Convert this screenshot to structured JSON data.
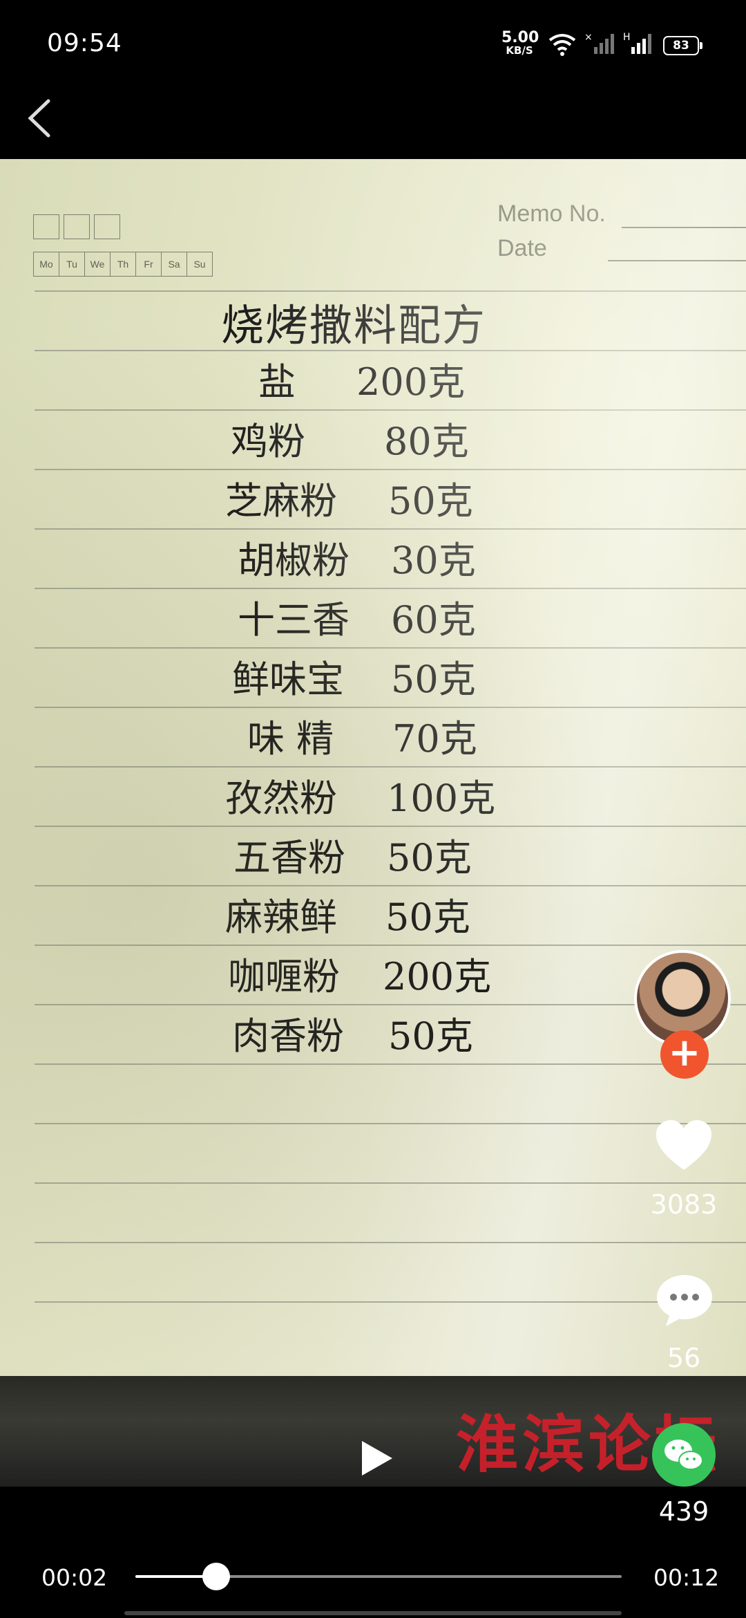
{
  "status": {
    "time": "09:54",
    "net_speed": "5.00",
    "net_unit": "KB/S",
    "battery": "83"
  },
  "memo": {
    "days": [
      "Mo",
      "Tu",
      "We",
      "Th",
      "Fr",
      "Sa",
      "Su"
    ],
    "memo_label": "Memo No.",
    "date_label": "Date",
    "title": "烧烤撒料配方",
    "rows": [
      {
        "name": "盐",
        "amount": "200克"
      },
      {
        "name": "鸡粉",
        "amount": "80克"
      },
      {
        "name": "芝麻粉",
        "amount": "50克"
      },
      {
        "name": "胡椒粉",
        "amount": "30克"
      },
      {
        "name": "十三香",
        "amount": "60克"
      },
      {
        "name": "鲜味宝",
        "amount": "50克"
      },
      {
        "name": "味 精",
        "amount": "70克"
      },
      {
        "name": "孜然粉",
        "amount": "100克"
      },
      {
        "name": "五香粉",
        "amount": "50克"
      },
      {
        "name": "麻辣鲜",
        "amount": "50克"
      },
      {
        "name": "咖喱粉",
        "amount": "200克"
      },
      {
        "name": "肉香粉",
        "amount": "50克"
      }
    ]
  },
  "watermark": "淮滨论坛",
  "actions": {
    "like_count": "3083",
    "comment_count": "56",
    "share_count": "439"
  },
  "player": {
    "current_time": "00:02",
    "total_time": "00:12",
    "progress": 0.166
  },
  "colors": {
    "follow": "#f0552e",
    "share": "#36c45a",
    "watermark": "#d3202b"
  }
}
